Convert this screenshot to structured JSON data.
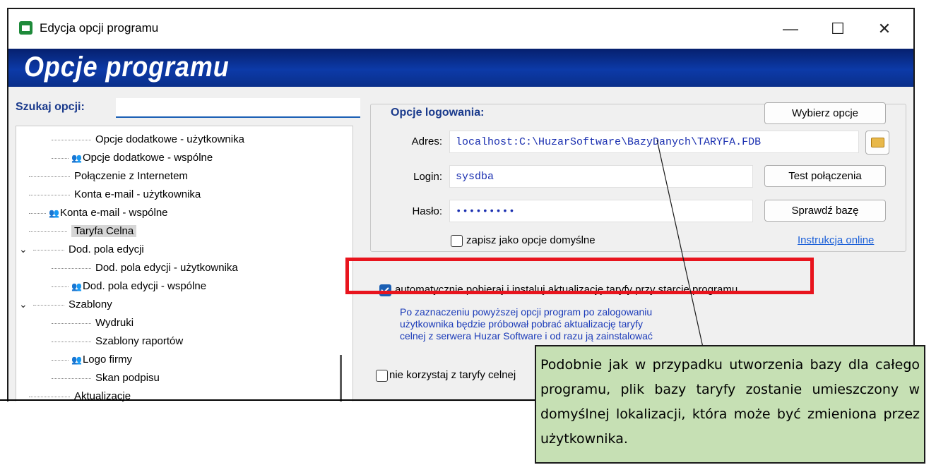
{
  "window": {
    "title": "Edycja opcji programu",
    "minimize": "—",
    "maximize": "☐",
    "close": "✕"
  },
  "banner": {
    "title": "Opcje programu"
  },
  "search": {
    "label": "Szukaj opcji:",
    "value": ""
  },
  "tree": {
    "items": [
      {
        "label": "Opcje dodatkowe - użytkownika"
      },
      {
        "label": "Opcje dodatkowe - wspólne"
      },
      {
        "label": "Połączenie z Internetem"
      },
      {
        "label": "Konta e-mail - użytkownika"
      },
      {
        "label": "Konta e-mail - wspólne"
      },
      {
        "label": "Taryfa Celna"
      },
      {
        "label": "Dod. pola edycji"
      },
      {
        "label": "Dod. pola edycji - użytkownika"
      },
      {
        "label": "Dod. pola edycji - wspólne"
      },
      {
        "label": "Szablony"
      },
      {
        "label": "Wydruki"
      },
      {
        "label": "Szablony raportów"
      },
      {
        "label": "Logo firmy"
      },
      {
        "label": "Skan podpisu"
      },
      {
        "label": "Aktualizacje"
      }
    ]
  },
  "login": {
    "group_label": "Opcje logowania:",
    "choose_button": "Wybierz opcje",
    "address_label": "Adres:",
    "address_value": "localhost:C:\\HuzarSoftware\\BazyDanych\\TARYFA.FDB",
    "login_label": "Login:",
    "login_value": "sysdba",
    "password_label": "Hasło:",
    "password_value": "•••••••••",
    "test_button": "Test połączenia",
    "check_button": "Sprawdź bazę",
    "save_default_label": "zapisz jako opcje domyślne",
    "online_link": "Instrukcja online"
  },
  "auto_update": {
    "label": "automatycznie pobieraj i instaluj aktualizację taryfy przy starcie programu",
    "checked": true,
    "note": [
      "Po zaznaczeniu powyższej opcji program po zalogowaniu",
      "użytkownika będzie próbował pobrać aktualizację taryfy",
      "celnej z serwera Huzar Software i od razu ją zainstalować"
    ]
  },
  "no_tariff": {
    "label": "nie korzystaj z taryfy celnej",
    "checked": false
  },
  "callout": {
    "text": "Podobnie jak w przypadku utworzenia bazy dla całego programu, plik bazy taryfy zostanie umieszczony w domyślnej lokalizacji, która może być zmieniona przez użytkownika."
  },
  "colors": {
    "accent": "#1a5fb4",
    "highlight": "#e8141d",
    "callout_bg": "#c6e0b4"
  }
}
